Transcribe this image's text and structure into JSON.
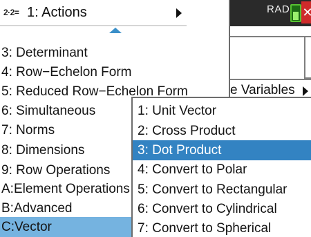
{
  "status_bar": {
    "angle_mode": "RAD",
    "close_symbol": "✕"
  },
  "background": {
    "variables_label": "e Variables"
  },
  "menu": {
    "title_icon": "2·2=",
    "title": "1: Actions",
    "items": [
      {
        "label": "3: Determinant"
      },
      {
        "label": "4: Row−Echelon Form"
      },
      {
        "label": "5: Reduced Row−Echelon Form"
      },
      {
        "label": "6: Simultaneous"
      },
      {
        "label": "7: Norms"
      },
      {
        "label": "8: Dimensions"
      },
      {
        "label": "9: Row Operations"
      },
      {
        "label": "A:Element Operations"
      },
      {
        "label": "B:Advanced"
      },
      {
        "label": "C:Vector"
      }
    ],
    "selected_index": 9
  },
  "submenu": {
    "items": [
      {
        "label": "1: Unit Vector"
      },
      {
        "label": "2: Cross Product"
      },
      {
        "label": "3: Dot Product"
      },
      {
        "label": "4: Convert to Polar"
      },
      {
        "label": "5: Convert to Rectangular"
      },
      {
        "label": "6: Convert to Cylindrical"
      },
      {
        "label": "7: Convert to Spherical"
      }
    ],
    "selected_index": 2
  },
  "colors": {
    "menu_highlight": "#75b3e0",
    "submenu_highlight": "#3383c2",
    "scroll_arrow": "#3a8fc9",
    "battery": "#58c232",
    "close": "#cf2b2b"
  },
  "icons": {
    "scroll_up": "triangle-up-icon",
    "submenu_arrow": "triangle-right-icon",
    "battery": "battery-icon",
    "close": "close-icon"
  }
}
